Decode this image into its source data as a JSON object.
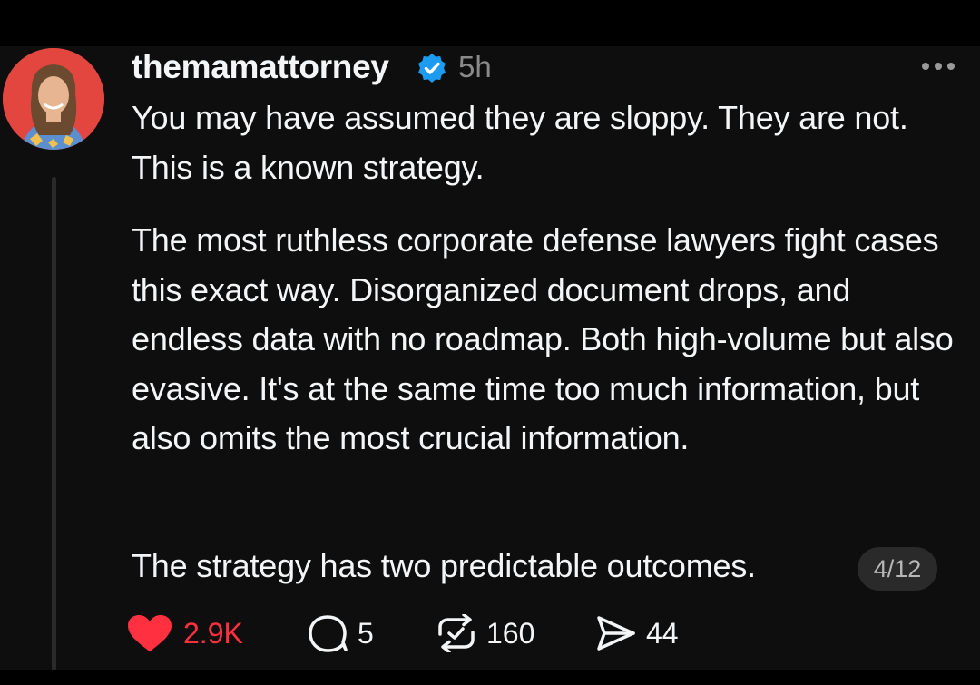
{
  "post": {
    "username": "themamattorney",
    "timestamp": "5h",
    "paragraphs": [
      "You may have assumed they are sloppy. They are not. This is a known strategy.",
      "The most ruthless corporate defense lawyers fight cases this exact way. Disorganized document drops, and endless data with no roadmap. Both high-volume but also evasive. It's at the same time too much information, but also omits the most crucial information.",
      "The strategy has two predictable outcomes."
    ],
    "page_indicator": "4/12",
    "actions": {
      "likes": "2.9K",
      "replies": "5",
      "reposts": "160",
      "shares": "44"
    },
    "liked": true,
    "verified": true
  },
  "icons": [
    "verified-badge-icon",
    "more-options-icon",
    "heart-icon",
    "reply-icon",
    "repost-icon",
    "share-icon"
  ],
  "colors": {
    "background": "#0e0e0e",
    "text": "#f3f5f7",
    "muted": "#8a8a8a",
    "like": "#ff3040",
    "verified": "#1d9bf0",
    "avatar_bg": "#e2463f"
  }
}
